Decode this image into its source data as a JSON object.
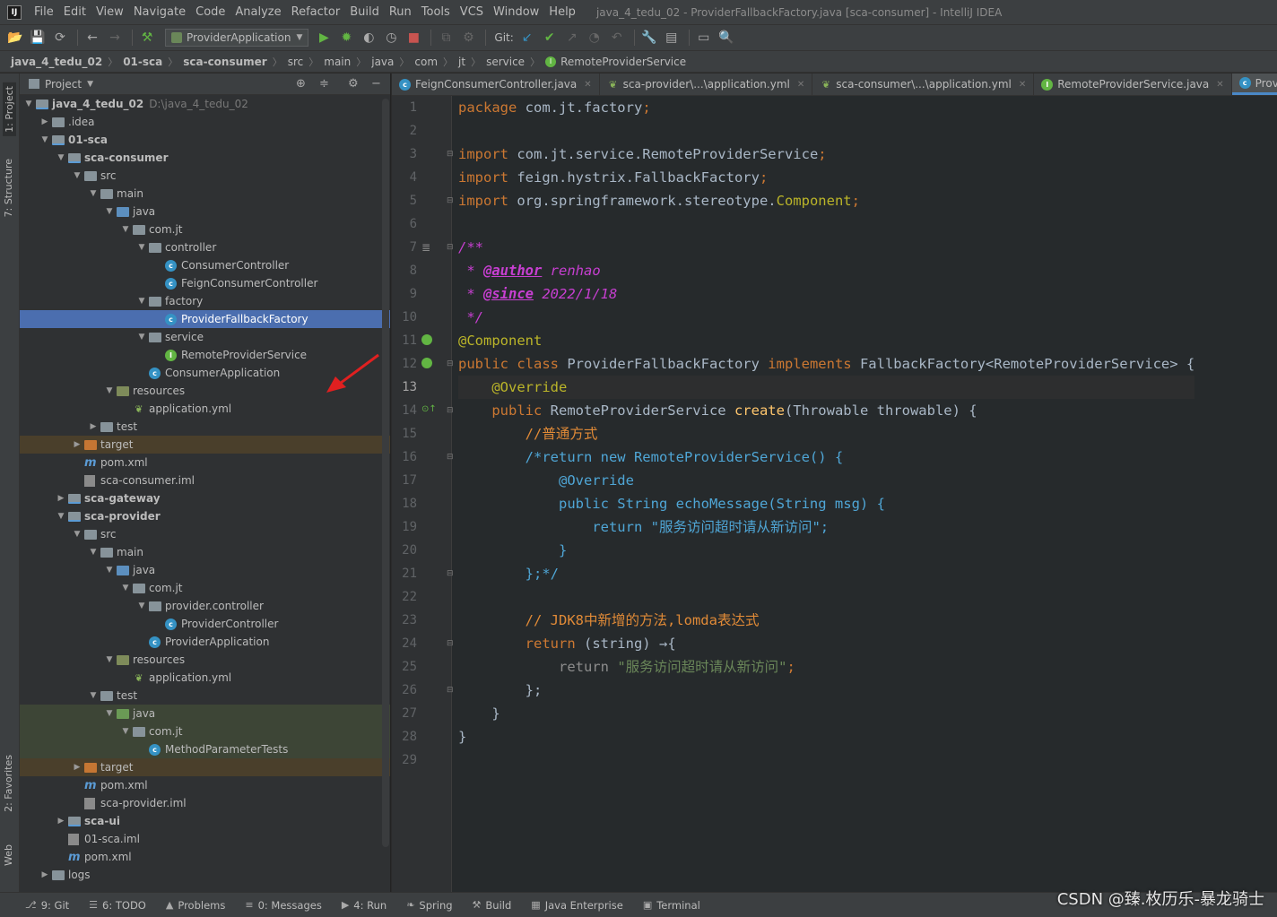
{
  "menubar": {
    "items": [
      "File",
      "Edit",
      "View",
      "Navigate",
      "Code",
      "Analyze",
      "Refactor",
      "Build",
      "Run",
      "Tools",
      "VCS",
      "Window",
      "Help"
    ],
    "window_title": "java_4_tedu_02 - ProviderFallbackFactory.java [sca-consumer] - IntelliJ IDEA"
  },
  "toolbar": {
    "run_config": "ProviderApplication",
    "git_label": "Git:"
  },
  "navbar": {
    "crumbs": [
      "java_4_tedu_02",
      "01-sca",
      "sca-consumer",
      "src",
      "main",
      "java",
      "com",
      "jt",
      "service",
      "RemoteProviderService"
    ]
  },
  "sidebar": {
    "project_tab": "1: Project",
    "structure_tab": "7: Structure",
    "favorites_tab": "2: Favorites",
    "web_tab": "Web"
  },
  "project_panel": {
    "title": "Project",
    "root_path": "D:\\java_4_tedu_02",
    "tree": [
      {
        "label": "java_4_tedu_02",
        "depth": 0,
        "arrow": "open",
        "icon": "module",
        "bold": true
      },
      {
        "label": ".idea",
        "depth": 1,
        "arrow": "closed",
        "icon": "folder"
      },
      {
        "label": "01-sca",
        "depth": 1,
        "arrow": "open",
        "icon": "module",
        "bold": true
      },
      {
        "label": "sca-consumer",
        "depth": 2,
        "arrow": "open",
        "icon": "module",
        "bold": true
      },
      {
        "label": "src",
        "depth": 3,
        "arrow": "open",
        "icon": "folder"
      },
      {
        "label": "main",
        "depth": 4,
        "arrow": "open",
        "icon": "folder"
      },
      {
        "label": "java",
        "depth": 5,
        "arrow": "open",
        "icon": "src"
      },
      {
        "label": "com.jt",
        "depth": 6,
        "arrow": "open",
        "icon": "folder"
      },
      {
        "label": "controller",
        "depth": 7,
        "arrow": "open",
        "icon": "folder"
      },
      {
        "label": "ConsumerController",
        "depth": 8,
        "arrow": "none",
        "icon": "class"
      },
      {
        "label": "FeignConsumerController",
        "depth": 8,
        "arrow": "none",
        "icon": "class"
      },
      {
        "label": "factory",
        "depth": 7,
        "arrow": "open",
        "icon": "folder"
      },
      {
        "label": "ProviderFallbackFactory",
        "depth": 8,
        "arrow": "none",
        "icon": "class",
        "selected": true
      },
      {
        "label": "service",
        "depth": 7,
        "arrow": "open",
        "icon": "folder"
      },
      {
        "label": "RemoteProviderService",
        "depth": 8,
        "arrow": "none",
        "icon": "iface"
      },
      {
        "label": "ConsumerApplication",
        "depth": 7,
        "arrow": "none",
        "icon": "class"
      },
      {
        "label": "resources",
        "depth": 5,
        "arrow": "open",
        "icon": "res"
      },
      {
        "label": "application.yml",
        "depth": 6,
        "arrow": "none",
        "icon": "yml"
      },
      {
        "label": "test",
        "depth": 4,
        "arrow": "closed",
        "icon": "folder"
      },
      {
        "label": "target",
        "depth": 3,
        "arrow": "closed",
        "icon": "orange",
        "excluded": true
      },
      {
        "label": "pom.xml",
        "depth": 3,
        "arrow": "none",
        "icon": "m"
      },
      {
        "label": "sca-consumer.iml",
        "depth": 3,
        "arrow": "none",
        "icon": "iml"
      },
      {
        "label": "sca-gateway",
        "depth": 2,
        "arrow": "closed",
        "icon": "module",
        "bold": true
      },
      {
        "label": "sca-provider",
        "depth": 2,
        "arrow": "open",
        "icon": "module",
        "bold": true
      },
      {
        "label": "src",
        "depth": 3,
        "arrow": "open",
        "icon": "folder"
      },
      {
        "label": "main",
        "depth": 4,
        "arrow": "open",
        "icon": "folder"
      },
      {
        "label": "java",
        "depth": 5,
        "arrow": "open",
        "icon": "src"
      },
      {
        "label": "com.jt",
        "depth": 6,
        "arrow": "open",
        "icon": "folder"
      },
      {
        "label": "provider.controller",
        "depth": 7,
        "arrow": "open",
        "icon": "folder"
      },
      {
        "label": "ProviderController",
        "depth": 8,
        "arrow": "none",
        "icon": "class"
      },
      {
        "label": "ProviderApplication",
        "depth": 7,
        "arrow": "none",
        "icon": "class"
      },
      {
        "label": "resources",
        "depth": 5,
        "arrow": "open",
        "icon": "res"
      },
      {
        "label": "application.yml",
        "depth": 6,
        "arrow": "none",
        "icon": "yml"
      },
      {
        "label": "test",
        "depth": 4,
        "arrow": "open",
        "icon": "folder"
      },
      {
        "label": "java",
        "depth": 5,
        "arrow": "open",
        "icon": "test",
        "testsrc": true
      },
      {
        "label": "com.jt",
        "depth": 6,
        "arrow": "open",
        "icon": "folder",
        "testsrc": true
      },
      {
        "label": "MethodParameterTests",
        "depth": 7,
        "arrow": "none",
        "icon": "class",
        "testsrc": true
      },
      {
        "label": "target",
        "depth": 3,
        "arrow": "closed",
        "icon": "orange",
        "excluded": true
      },
      {
        "label": "pom.xml",
        "depth": 3,
        "arrow": "none",
        "icon": "m"
      },
      {
        "label": "sca-provider.iml",
        "depth": 3,
        "arrow": "none",
        "icon": "iml"
      },
      {
        "label": "sca-ui",
        "depth": 2,
        "arrow": "closed",
        "icon": "module",
        "bold": true
      },
      {
        "label": "01-sca.iml",
        "depth": 2,
        "arrow": "none",
        "icon": "iml"
      },
      {
        "label": "pom.xml",
        "depth": 2,
        "arrow": "none",
        "icon": "m"
      },
      {
        "label": "logs",
        "depth": 1,
        "arrow": "closed",
        "icon": "folder"
      }
    ]
  },
  "editor_tabs": [
    {
      "label": "FeignConsumerController.java",
      "icon": "class"
    },
    {
      "label": "sca-provider\\...\\application.yml",
      "icon": "yml"
    },
    {
      "label": "sca-consumer\\...\\application.yml",
      "icon": "yml"
    },
    {
      "label": "RemoteProviderService.java",
      "icon": "iface"
    },
    {
      "label": "ProviderF",
      "icon": "class",
      "active": true
    }
  ],
  "editor": {
    "current_line": 13,
    "lines": [
      [
        {
          "t": "package ",
          "c": "kw"
        },
        {
          "t": "com.jt.factory",
          "c": ""
        },
        {
          "t": ";",
          "c": "kw"
        }
      ],
      [],
      [
        {
          "t": "import ",
          "c": "kw"
        },
        {
          "t": "com.jt.service.RemoteProviderService",
          "c": ""
        },
        {
          "t": ";",
          "c": "kw"
        }
      ],
      [
        {
          "t": "import ",
          "c": "kw"
        },
        {
          "t": "feign.hystrix.FallbackFactory",
          "c": ""
        },
        {
          "t": ";",
          "c": "kw"
        }
      ],
      [
        {
          "t": "import ",
          "c": "kw"
        },
        {
          "t": "org.springframework.stereotype.",
          "c": ""
        },
        {
          "t": "Component",
          "c": "ann"
        },
        {
          "t": ";",
          "c": "kw"
        }
      ],
      [],
      [
        {
          "t": "/**",
          "c": "doc"
        }
      ],
      [
        {
          "t": " * ",
          "c": "doc"
        },
        {
          "t": "@author",
          "c": "doctag"
        },
        {
          "t": " renhao",
          "c": "doc"
        }
      ],
      [
        {
          "t": " * ",
          "c": "doc"
        },
        {
          "t": "@since",
          "c": "doctag"
        },
        {
          "t": " 2022/1/18",
          "c": "doc"
        }
      ],
      [
        {
          "t": " */",
          "c": "doc"
        }
      ],
      [
        {
          "t": "@Component",
          "c": "ann"
        }
      ],
      [
        {
          "t": "public class ",
          "c": "kw"
        },
        {
          "t": "ProviderFallbackFactory ",
          "c": ""
        },
        {
          "t": "implements ",
          "c": "kw"
        },
        {
          "t": "FallbackFactory<RemoteProviderService> {",
          "c": ""
        }
      ],
      [
        {
          "t": "    ",
          "c": ""
        },
        {
          "t": "@Override",
          "c": "ann"
        }
      ],
      [
        {
          "t": "    ",
          "c": ""
        },
        {
          "t": "public ",
          "c": "kw"
        },
        {
          "t": "RemoteProviderService ",
          "c": ""
        },
        {
          "t": "create",
          "c": "fn"
        },
        {
          "t": "(Throwable throwable) {",
          "c": ""
        }
      ],
      [
        {
          "t": "        ",
          "c": ""
        },
        {
          "t": "//普通方式",
          "c": "cmt"
        }
      ],
      [
        {
          "t": "        ",
          "c": ""
        },
        {
          "t": "/*return new RemoteProviderService() {",
          "c": "blk"
        }
      ],
      [
        {
          "t": "            @Override",
          "c": "blk"
        }
      ],
      [
        {
          "t": "            public String echoMessage(String msg) {",
          "c": "blk"
        }
      ],
      [
        {
          "t": "                return \"服务访问超时请从新访问\";",
          "c": "blk"
        }
      ],
      [
        {
          "t": "            }",
          "c": "blk"
        }
      ],
      [
        {
          "t": "        };*/",
          "c": "blk"
        }
      ],
      [],
      [
        {
          "t": "        ",
          "c": ""
        },
        {
          "t": "// JDK8中新增的方法,lomda表达式",
          "c": "cmt"
        }
      ],
      [
        {
          "t": "        ",
          "c": ""
        },
        {
          "t": "return ",
          "c": "kw"
        },
        {
          "t": "(string) ",
          "c": ""
        },
        {
          "t": "→{",
          "c": ""
        }
      ],
      [
        {
          "t": "            ",
          "c": ""
        },
        {
          "t": "return ",
          "c": "dimmed"
        },
        {
          "t": "\"服务访问超时请从新访问\"",
          "c": "str"
        },
        {
          "t": ";",
          "c": "kw"
        }
      ],
      [
        {
          "t": "        };",
          "c": ""
        }
      ],
      [
        {
          "t": "    }",
          "c": ""
        }
      ],
      [
        {
          "t": "}",
          "c": ""
        }
      ],
      []
    ]
  },
  "bottom_bar": {
    "tools": [
      {
        "icon": "git-icon",
        "glyph": "⎇",
        "label": "9: Git"
      },
      {
        "icon": "todo-icon",
        "glyph": "☰",
        "label": "6: TODO"
      },
      {
        "icon": "problems-icon",
        "glyph": "▲",
        "label": "Problems"
      },
      {
        "icon": "messages-icon",
        "glyph": "≡",
        "label": "0: Messages"
      },
      {
        "icon": "run-icon",
        "glyph": "▶",
        "label": "4: Run"
      },
      {
        "icon": "spring-icon",
        "glyph": "❧",
        "label": "Spring"
      },
      {
        "icon": "build-icon",
        "glyph": "⚒",
        "label": "Build"
      },
      {
        "icon": "java-enterprise-icon",
        "glyph": "▦",
        "label": "Java Enterprise"
      },
      {
        "icon": "terminal-icon",
        "glyph": "▣",
        "label": "Terminal"
      }
    ],
    "watermark": "CSDN @臻.枚历乐-暴龙骑士"
  }
}
